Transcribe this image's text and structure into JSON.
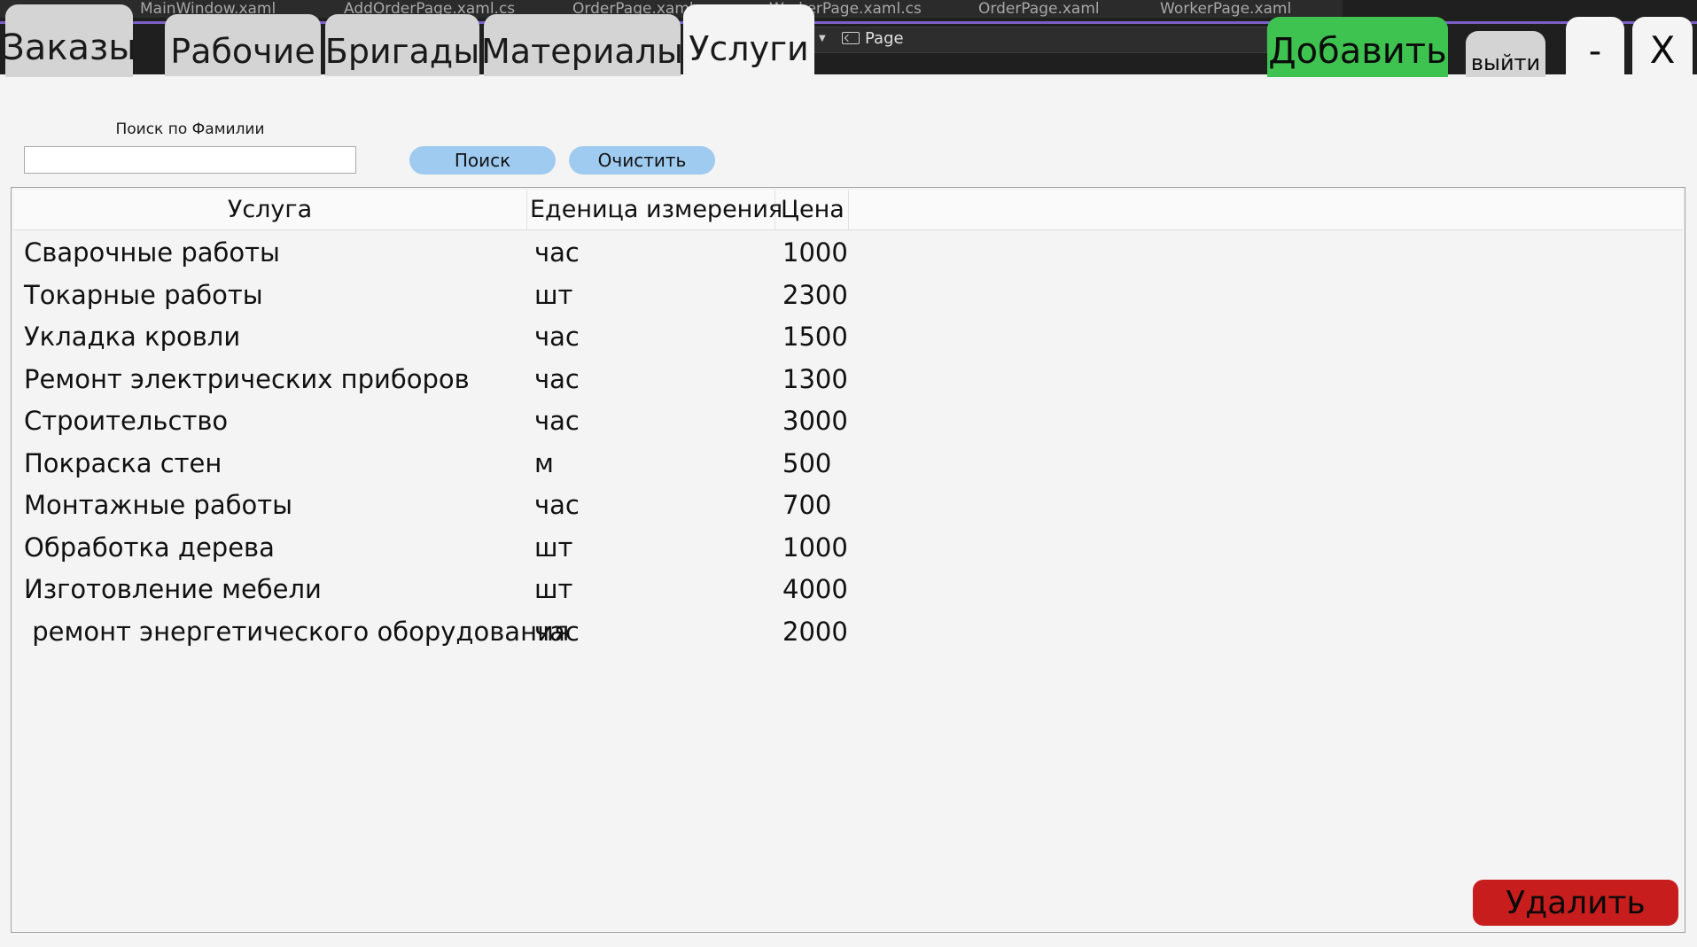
{
  "ide": {
    "file_tabs": [
      "MainWindow.xaml",
      "AddOrderPage.xaml.cs",
      "OrderPage.xaml",
      "WorkerPage.xaml.cs",
      "OrderPage.xaml",
      "WorkerPage.xaml"
    ],
    "toolbar_item": "Page"
  },
  "tabs": [
    {
      "label": "Заказы",
      "active": false
    },
    {
      "label": "Рабочие",
      "active": false
    },
    {
      "label": "Бригады",
      "active": false
    },
    {
      "label": "Материалы",
      "active": false
    },
    {
      "label": "Услуги",
      "active": true
    }
  ],
  "header_buttons": {
    "add": "Добавить",
    "exit": "выйти",
    "minimize": "-",
    "close": "X"
  },
  "colors": {
    "add_button": "#3fc350",
    "delete_button": "#c81d1d",
    "pill_button": "#9fcbf0",
    "background": "#f4f4f4"
  },
  "search": {
    "label": "Поиск по Фамилии",
    "value": "",
    "search_button": "Поиск",
    "clear_button": "Очистить"
  },
  "table": {
    "columns": [
      "Услуга",
      "Еденица измерения",
      "Цена"
    ],
    "rows": [
      [
        "Сварочные работы",
        "час",
        "1000"
      ],
      [
        "Токарные работы",
        "шт",
        "2300"
      ],
      [
        "Укладка кровли",
        "час",
        "1500"
      ],
      [
        "Ремонт электрических приборов",
        "час",
        "1300"
      ],
      [
        "Строительство",
        "час",
        "3000"
      ],
      [
        "Покраска стен",
        "м",
        "500"
      ],
      [
        "Монтажные работы",
        "час",
        "700"
      ],
      [
        "Обработка дерева",
        "шт",
        "1000"
      ],
      [
        "Изготовление мебели",
        "шт",
        "4000"
      ],
      [
        " ремонт энергетического оборудования",
        "час",
        "2000"
      ]
    ]
  },
  "delete_button": "Удалить"
}
